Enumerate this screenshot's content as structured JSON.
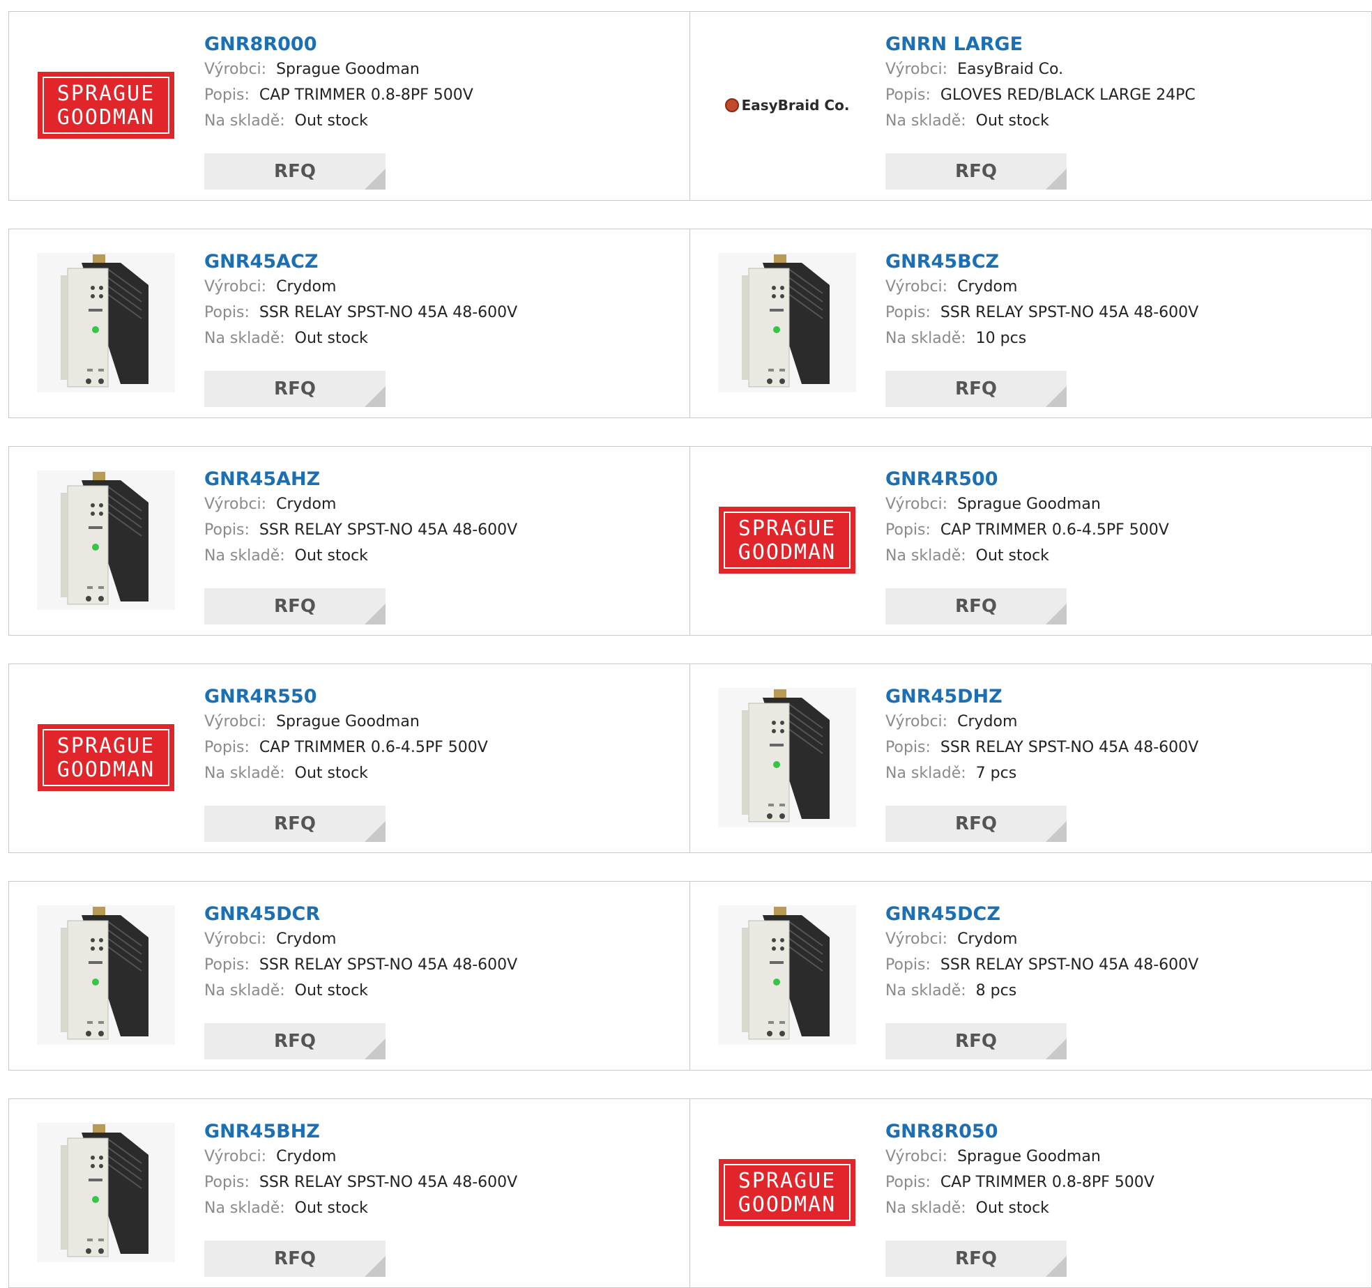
{
  "labels": {
    "manufacturer": "Výrobci:",
    "description": "Popis:",
    "stock": "Na skladě:",
    "rfq": "RFQ"
  },
  "logos": {
    "sprague_line1": "SPRAGUE",
    "sprague_line2": "GOODMAN",
    "easybraid": "EasyBraid Co."
  },
  "colors": {
    "link": "#1a6fb5",
    "sprague_red": "#e0252b"
  },
  "products": [
    {
      "pn": "GNR8R000",
      "manufacturer": "Sprague Goodman",
      "description": "CAP TRIMMER 0.8-8PF 500V",
      "stock": "Out stock",
      "image": "sprague-logo"
    },
    {
      "pn": "GNRN LARGE",
      "manufacturer": "EasyBraid Co.",
      "description": "GLOVES RED/BLACK LARGE 24PC",
      "stock": "Out stock",
      "image": "easybraid-logo"
    },
    {
      "pn": "GNR45ACZ",
      "manufacturer": "Crydom",
      "description": "SSR RELAY SPST-NO 45A 48-600V",
      "stock": "Out stock",
      "image": "relay-photo"
    },
    {
      "pn": "GNR45BCZ",
      "manufacturer": "Crydom",
      "description": "SSR RELAY SPST-NO 45A 48-600V",
      "stock": "10 pcs",
      "image": "relay-photo"
    },
    {
      "pn": "GNR45AHZ",
      "manufacturer": "Crydom",
      "description": "SSR RELAY SPST-NO 45A 48-600V",
      "stock": "Out stock",
      "image": "relay-photo"
    },
    {
      "pn": "GNR4R500",
      "manufacturer": "Sprague Goodman",
      "description": "CAP TRIMMER 0.6-4.5PF 500V",
      "stock": "Out stock",
      "image": "sprague-logo"
    },
    {
      "pn": "GNR4R550",
      "manufacturer": "Sprague Goodman",
      "description": "CAP TRIMMER 0.6-4.5PF 500V",
      "stock": "Out stock",
      "image": "sprague-logo"
    },
    {
      "pn": "GNR45DHZ",
      "manufacturer": "Crydom",
      "description": "SSR RELAY SPST-NO 45A 48-600V",
      "stock": "7 pcs",
      "image": "relay-photo"
    },
    {
      "pn": "GNR45DCR",
      "manufacturer": "Crydom",
      "description": "SSR RELAY SPST-NO 45A 48-600V",
      "stock": "Out stock",
      "image": "relay-photo"
    },
    {
      "pn": "GNR45DCZ",
      "manufacturer": "Crydom",
      "description": "SSR RELAY SPST-NO 45A 48-600V",
      "stock": "8 pcs",
      "image": "relay-photo"
    },
    {
      "pn": "GNR45BHZ",
      "manufacturer": "Crydom",
      "description": "SSR RELAY SPST-NO 45A 48-600V",
      "stock": "Out stock",
      "image": "relay-photo"
    },
    {
      "pn": "GNR8R050",
      "manufacturer": "Sprague Goodman",
      "description": "CAP TRIMMER 0.8-8PF 500V",
      "stock": "Out stock",
      "image": "sprague-logo"
    }
  ]
}
